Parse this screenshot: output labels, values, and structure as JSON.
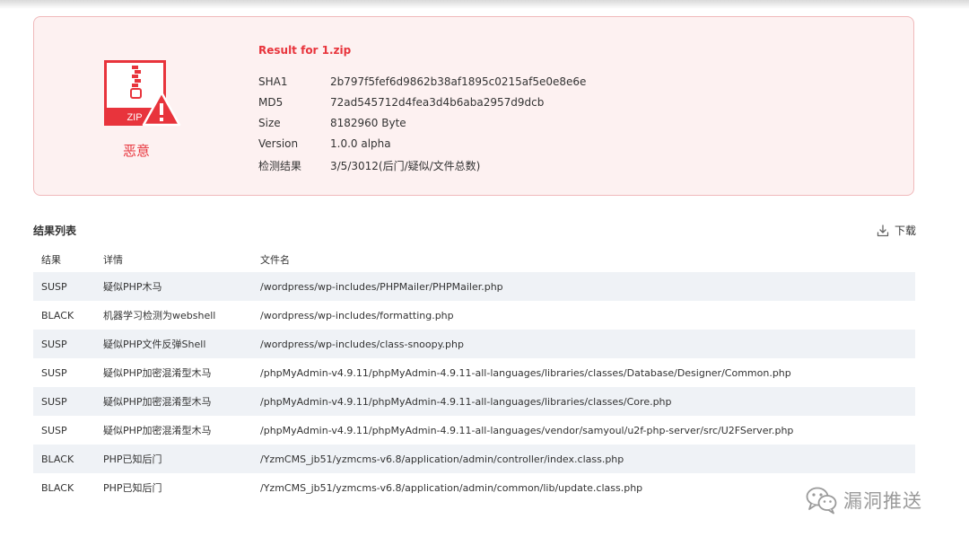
{
  "summary": {
    "title": "Result for 1.zip",
    "file_type_label": "ZIP",
    "verdict": "恶意",
    "fields": [
      {
        "key": "SHA1",
        "value": "2b797f5fef6d9862b38af1895c0215af5e0e8e6e"
      },
      {
        "key": "MD5",
        "value": "72ad545712d4fea3d4b6aba2957d9dcb"
      },
      {
        "key": "Size",
        "value": "8182960 Byte"
      },
      {
        "key": "Version",
        "value": "1.0.0 alpha"
      },
      {
        "key": "检测结果",
        "value": "3/5/3012(后门/疑似/文件总数)"
      }
    ]
  },
  "results": {
    "title": "结果列表",
    "download_label": "下载",
    "columns": [
      "结果",
      "详情",
      "文件名"
    ],
    "rows": [
      [
        "SUSP",
        "疑似PHP木马",
        "/wordpress/wp-includes/PHPMailer/PHPMailer.php"
      ],
      [
        "BLACK",
        "机器学习检测为webshell",
        "/wordpress/wp-includes/formatting.php"
      ],
      [
        "SUSP",
        "疑似PHP文件反弹Shell",
        "/wordpress/wp-includes/class-snoopy.php"
      ],
      [
        "SUSP",
        "疑似PHP加密混淆型木马",
        "/phpMyAdmin-v4.9.11/phpMyAdmin-4.9.11-all-languages/libraries/classes/Database/Designer/Common.php"
      ],
      [
        "SUSP",
        "疑似PHP加密混淆型木马",
        "/phpMyAdmin-v4.9.11/phpMyAdmin-4.9.11-all-languages/libraries/classes/Core.php"
      ],
      [
        "SUSP",
        "疑似PHP加密混淆型木马",
        "/phpMyAdmin-v4.9.11/phpMyAdmin-4.9.11-all-languages/vendor/samyoul/u2f-php-server/src/U2FServer.php"
      ],
      [
        "BLACK",
        "PHP已知后门",
        "/YzmCMS_jb51/yzmcms-v6.8/application/admin/controller/index.class.php"
      ],
      [
        "BLACK",
        "PHP已知后门",
        "/YzmCMS_jb51/yzmcms-v6.8/application/admin/common/lib/update.class.php"
      ]
    ]
  },
  "watermark": {
    "text": "漏洞推送",
    "icon": "wechat-icon"
  },
  "colors": {
    "danger": "#e8343c",
    "card_background": "#fdf1f1",
    "card_border": "#f0b9bb",
    "row_stripe": "#eff2f6",
    "watermark": "#9a9a9a"
  }
}
